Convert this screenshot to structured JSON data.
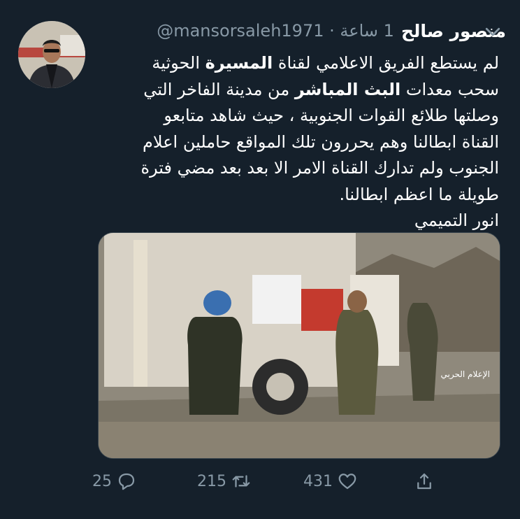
{
  "tweet": {
    "display_name": "منصور صالح",
    "handle": "@mansorsaleh1971",
    "separator": "·",
    "time": "1 ساعة",
    "text_lines": [
      [
        "لم يستطع الفريق الاعلامي لقناة ",
        "المسيرة",
        " الحوثية"
      ],
      [
        "سحب معدات ",
        "البث المباشر",
        " من مدينة الفاخر التي"
      ],
      [
        "وصلتها طلائع القوات الجنوبية ، حيث شاهد متابعو"
      ],
      [
        "القناة ابطالنا وهم يحررون تلك المواقع حاملين اعلام"
      ],
      [
        "الجنوب ولم تدارك القناة الامر الا بعد بعد مضي فترة"
      ],
      [
        "طويلة ما اعظم ابطالنا."
      ],
      [
        "انور التميمي"
      ]
    ],
    "media_watermark": "الإعلام الحربي"
  },
  "actions": {
    "reply_count": "25",
    "retweet_count": "215",
    "like_count": "431"
  },
  "colors": {
    "background": "#15202b",
    "secondary_text": "#8899a6",
    "primary_text": "#ffffff"
  },
  "icons": [
    "chevron-down-icon",
    "reply-icon",
    "retweet-icon",
    "like-icon",
    "share-icon"
  ]
}
